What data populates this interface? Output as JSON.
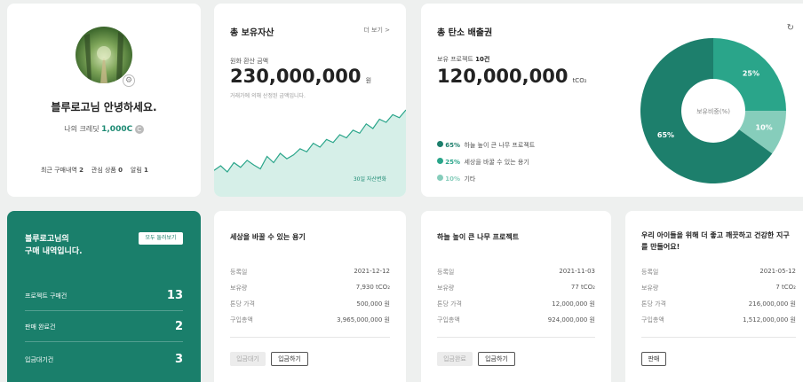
{
  "profile": {
    "greeting": "블루로고님 안녕하세요.",
    "credit_label": "나의 크레딧",
    "credit_value": "1,000C",
    "stats": [
      {
        "label": "최근 구매내역",
        "count": "2"
      },
      {
        "label": "관심 상품",
        "count": "0"
      },
      {
        "label": "알림",
        "count": "1"
      }
    ]
  },
  "assets": {
    "title": "총 보유자산",
    "more_label": "더 보기",
    "more_arrow": ">",
    "value_label": "원화 환산 금액",
    "amount": "230,000,000",
    "unit": "원",
    "note": "거래가에 의해 산정된 금액입니다.",
    "chart_caption": "30일 자산변화",
    "chart_data": {
      "type": "area",
      "values": [
        20,
        26,
        18,
        30,
        24,
        33,
        27,
        22,
        38,
        30,
        42,
        35,
        40,
        48,
        44,
        55,
        50,
        60,
        56,
        66,
        62,
        72,
        68,
        80,
        74,
        86,
        82,
        92,
        88,
        98
      ]
    }
  },
  "carbon": {
    "title": "총 탄소 배출권",
    "refresh_icon": "refresh-icon",
    "projects_label": "보유 프로젝트",
    "projects_count": "10건",
    "amount": "120,000,000",
    "unit": "tCO₂",
    "legend": [
      {
        "pct": "65%",
        "label": "하늘 높이 큰 나무 프로젝트",
        "color": "#1d7f6c"
      },
      {
        "pct": "25%",
        "label": "세상을 바꿀 수 있는 용기",
        "color": "#2aa58a"
      },
      {
        "pct": "10%",
        "label": "기타",
        "color": "#86cdbb"
      }
    ],
    "donut_center": "보유비중(%)",
    "chart_data": {
      "type": "pie",
      "categories": [
        "하늘 높이 큰 나무 프로젝트",
        "세상을 바꿀 수 있는 용기",
        "기타"
      ],
      "values": [
        65,
        25,
        10
      ],
      "labels": [
        "65%",
        "25%",
        "10%"
      ],
      "colors": [
        "#1d7f6c",
        "#2aa58a",
        "#86cdbb"
      ]
    }
  },
  "purchase": {
    "title_line1": "블루로고님의",
    "title_line2": "구매 내역입니다.",
    "view_all": "모두 둘러보기",
    "rows": [
      {
        "label": "프로젝트 구매건",
        "count": "13"
      },
      {
        "label": "판매 완료건",
        "count": "2"
      },
      {
        "label": "입금대기건",
        "count": "3"
      }
    ]
  },
  "projects": [
    {
      "title": "세상을 바꿀 수 있는 용기",
      "rows": [
        {
          "label": "등록일",
          "value": "2021-12-12"
        },
        {
          "label": "보유량",
          "value": "7,930 tCO₂"
        },
        {
          "label": "톤당 가격",
          "value": "500,000 원"
        },
        {
          "label": "구입총액",
          "value": "3,965,000,000 원"
        }
      ],
      "buttons": [
        {
          "label": "입금대기",
          "disabled": true
        },
        {
          "label": "입금하기",
          "disabled": false
        }
      ]
    },
    {
      "title": "하늘 높이 큰 나무 프로젝트",
      "rows": [
        {
          "label": "등록일",
          "value": "2021-11-03"
        },
        {
          "label": "보유량",
          "value": "77 tCO₂"
        },
        {
          "label": "톤당 가격",
          "value": "12,000,000 원"
        },
        {
          "label": "구입총액",
          "value": "924,000,000 원"
        }
      ],
      "buttons": [
        {
          "label": "입금완료",
          "disabled": true
        },
        {
          "label": "입금하기",
          "disabled": false
        }
      ]
    },
    {
      "title": "우리 아이들을 위해 더 좋고 깨끗하고 건강한 지구를 만들어요!",
      "rows": [
        {
          "label": "등록일",
          "value": "2021-05-12"
        },
        {
          "label": "보유량",
          "value": "7 tCO₂"
        },
        {
          "label": "톤당 가격",
          "value": "216,000,000 원"
        },
        {
          "label": "구입총액",
          "value": "1,512,000,000 원"
        }
      ],
      "buttons": [
        {
          "label": "판매",
          "disabled": false
        }
      ]
    }
  ]
}
